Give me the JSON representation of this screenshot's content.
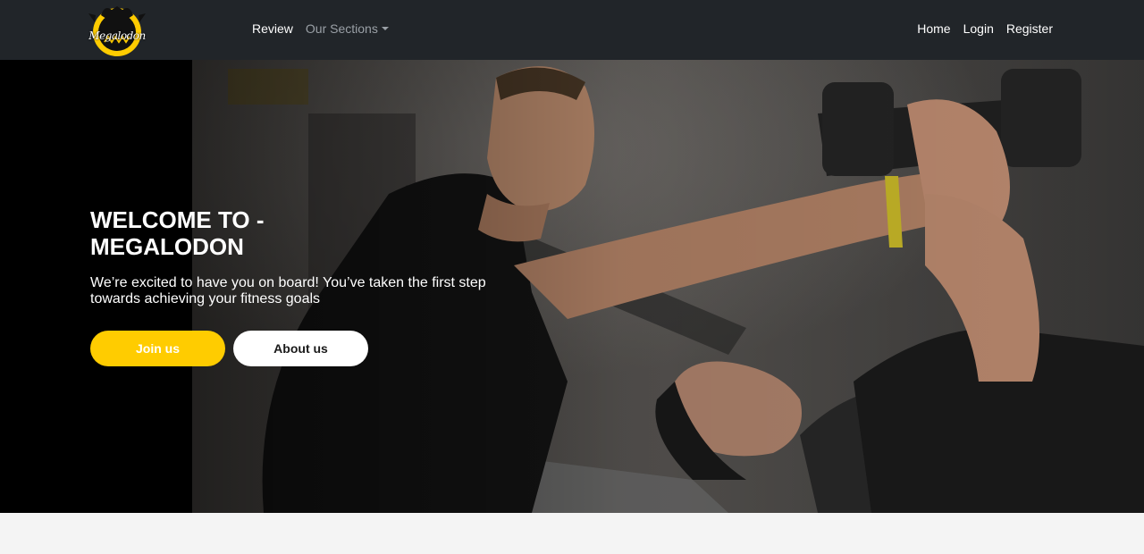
{
  "brand": {
    "logo_text": "Megalodon",
    "accent_color": "#ffcc00"
  },
  "nav": {
    "left": [
      {
        "label": "Review"
      },
      {
        "label": "Our Sections",
        "dropdown": true
      }
    ],
    "right": [
      {
        "label": "Home"
      },
      {
        "label": "Login"
      },
      {
        "label": "Register"
      }
    ]
  },
  "hero": {
    "title_line1": "WELCOME TO -",
    "title_line2": "MEGALODON",
    "subtitle": "We’re excited to have you on board! You’ve taken the first step towards achieving your fitness goals",
    "primary_button": "Join us",
    "secondary_button": "About us"
  }
}
